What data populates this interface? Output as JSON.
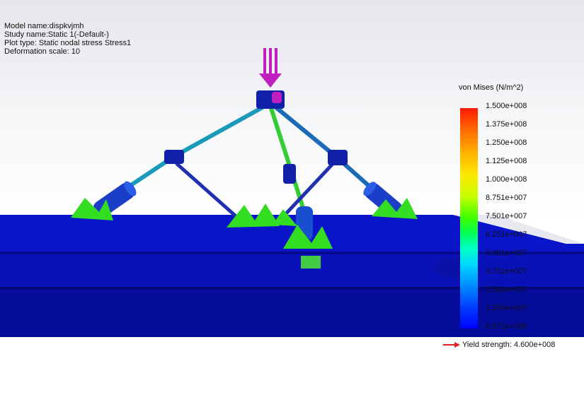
{
  "info": {
    "model_name": "Model name:dispkvjmh",
    "study_name": "Study name:Static 1(-Default-)",
    "plot_type": "Plot type: Static nodal stress Stress1",
    "deformation_scale": "Deformation scale: 10"
  },
  "legend": {
    "title": "von Mises (N/m^2)",
    "ticks": [
      "1.500e+008",
      "1.375e+008",
      "1.250e+008",
      "1.125e+008",
      "1.000e+008",
      "8.751e+007",
      "7.501e+007",
      "6.251e+007",
      "5.001e+007",
      "3.751e+007",
      "2.500e+007",
      "1.250e+007",
      "6.071e+005"
    ],
    "yield": "Yield strength: 4.600e+008",
    "colors": {
      "max": "#ff1a00",
      "min": "#0000ff",
      "yield_arrow": "#e02020"
    }
  },
  "model": {
    "base_color": "#0a10c8",
    "link_color": "#1aa0b8",
    "fixture_color": "#22dd22",
    "load_color": "#c020c0"
  }
}
